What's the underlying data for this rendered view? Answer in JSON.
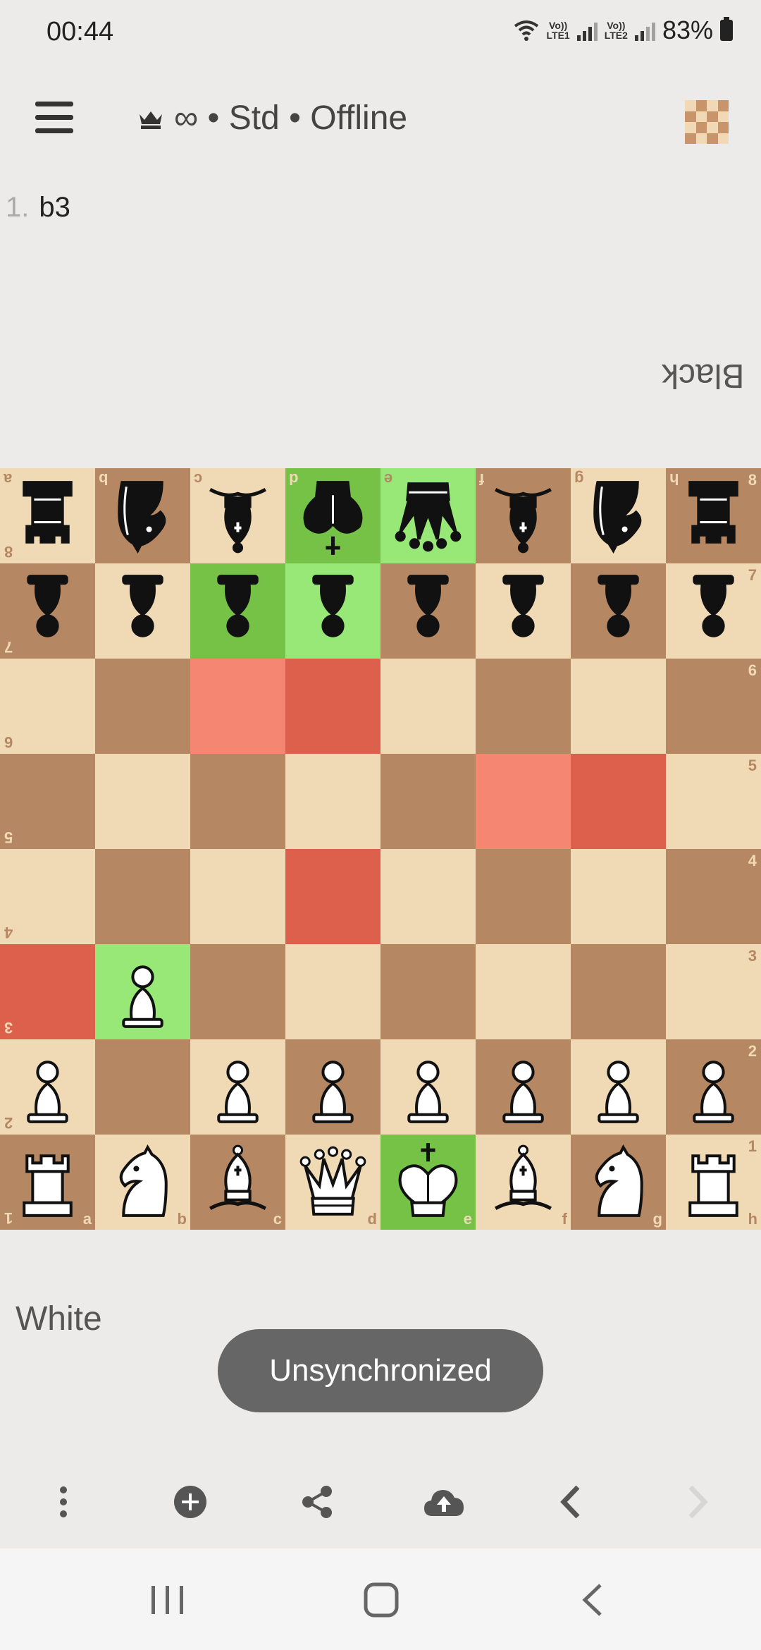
{
  "status": {
    "time": "00:44",
    "lte1": "Vo))\nLTE1",
    "lte2": "Vo))\nLTE2",
    "battery": "83%"
  },
  "appbar": {
    "title": "∞ • Std • Offline"
  },
  "moves": [
    {
      "number": "1.",
      "san": "b3"
    }
  ],
  "players": {
    "top": "Black",
    "bottom": "White"
  },
  "board": {
    "ranks": [
      [
        "br",
        "bn",
        "bb",
        "bk",
        "bq",
        "bb",
        "bn",
        "br"
      ],
      [
        "bp",
        "bp",
        "bp",
        "bp",
        "bp",
        "bp",
        "bp",
        "bp"
      ],
      [
        "",
        "",
        "",
        "",
        "",
        "",
        "",
        ""
      ],
      [
        "",
        "",
        "",
        "",
        "",
        "",
        "",
        ""
      ],
      [
        "",
        "",
        "",
        "",
        "",
        "",
        "",
        ""
      ],
      [
        "",
        "wp",
        "",
        "",
        "",
        "",
        "",
        ""
      ],
      [
        "wp",
        "",
        "wp",
        "wp",
        "wp",
        "wp",
        "wp",
        "wp"
      ],
      [
        "wr",
        "wn",
        "wb",
        "wq",
        "wk",
        "wb",
        "wn",
        "wr"
      ]
    ],
    "rotated_rank_1": [
      "r",
      "n",
      "b",
      "k",
      "q",
      "b",
      "n",
      "r"
    ],
    "highlights": {
      "a3": "#dc604c",
      "b3": "#98e877",
      "c7": "#76c247",
      "d7": "#98e877",
      "d8": "#76c247",
      "e8": "#98e877",
      "e1": "#76c247",
      "c6": "#f58772",
      "d6": "#dc604c",
      "f5": "#f58772",
      "g5": "#dc604c",
      "d4": "#dc604c"
    },
    "files": [
      "a",
      "b",
      "c",
      "d",
      "e",
      "f",
      "g",
      "h"
    ],
    "ranks_labels": [
      "8",
      "7",
      "6",
      "5",
      "4",
      "3",
      "2",
      "1"
    ]
  },
  "toast": "Unsynchronized",
  "toolbar": [
    "more-vertical-icon",
    "add-circle-icon",
    "share-icon",
    "cloud-upload-icon",
    "chevron-left-icon",
    "chevron-right-icon"
  ],
  "colors": {
    "light": "#f0d9b5",
    "dark": "#b58863",
    "toast": "#666666"
  }
}
